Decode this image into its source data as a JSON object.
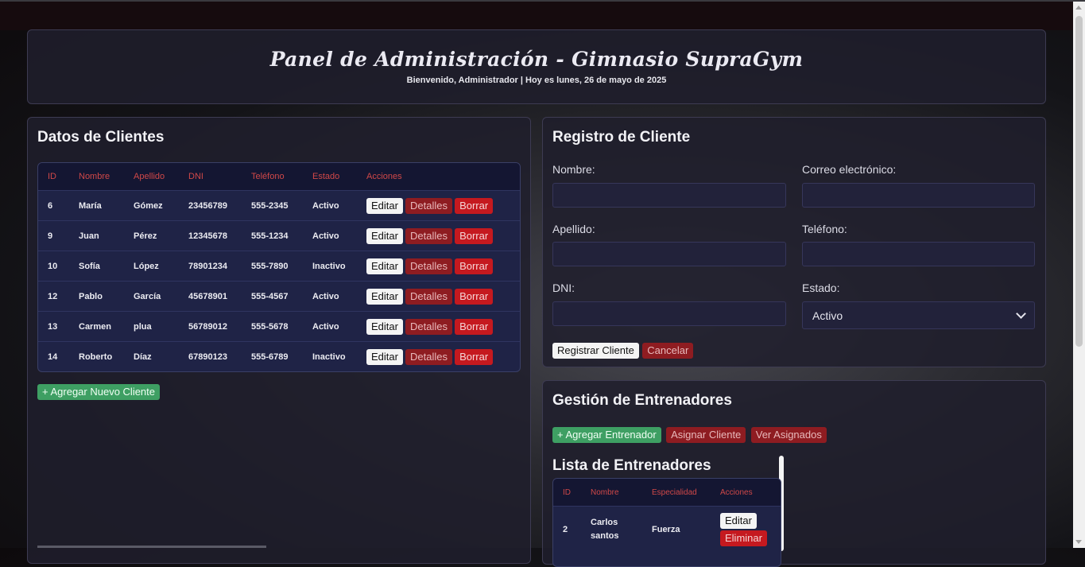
{
  "header": {
    "title": "Panel de Administración - Gimnasio SupraGym",
    "subtitle": "Bienvenido, Administrador | Hoy es lunes, 26 de mayo de 2025"
  },
  "clients": {
    "title": "Datos de Clientes",
    "columns": [
      "ID",
      "Nombre",
      "Apellido",
      "DNI",
      "Teléfono",
      "Estado",
      "Acciones"
    ],
    "rows": [
      {
        "id": "6",
        "nombre": "María",
        "apellido": "Gómez",
        "dni": "23456789",
        "telefono": "555-2345",
        "estado": "Activo"
      },
      {
        "id": "9",
        "nombre": "Juan",
        "apellido": "Pérez",
        "dni": "12345678",
        "telefono": "555-1234",
        "estado": "Activo"
      },
      {
        "id": "10",
        "nombre": "Sofía",
        "apellido": "López",
        "dni": "78901234",
        "telefono": "555-7890",
        "estado": "Inactivo"
      },
      {
        "id": "12",
        "nombre": "Pablo",
        "apellido": "García",
        "dni": "45678901",
        "telefono": "555-4567",
        "estado": "Activo"
      },
      {
        "id": "13",
        "nombre": "Carmen",
        "apellido": "plua",
        "dni": "56789012",
        "telefono": "555-5678",
        "estado": "Activo"
      },
      {
        "id": "14",
        "nombre": "Roberto",
        "apellido": "Díaz",
        "dni": "67890123",
        "telefono": "555-6789",
        "estado": "Inactivo"
      }
    ],
    "actions": {
      "edit": "Editar",
      "details": "Detalles",
      "delete": "Borrar"
    },
    "add_button": "+ Agregar Nuevo Cliente"
  },
  "register": {
    "title": "Registro de Cliente",
    "labels": {
      "nombre": "Nombre:",
      "correo": "Correo electrónico:",
      "apellido": "Apellido:",
      "telefono": "Teléfono:",
      "dni": "DNI:",
      "estado": "Estado:"
    },
    "estado_selected": "Activo",
    "submit": "Registrar Cliente",
    "cancel": "Cancelar"
  },
  "trainers": {
    "title": "Gestión de Entrenadores",
    "buttons": {
      "add": "+ Agregar Entrenador",
      "assign": "Asignar Cliente",
      "view": "Ver Asignados"
    },
    "list_title": "Lista de Entrenadores",
    "columns": [
      "ID",
      "Nombre",
      "Especialidad",
      "Acciones"
    ],
    "rows": [
      {
        "id": "2",
        "nombre": "Carlos santos",
        "especialidad": "Fuerza"
      }
    ],
    "actions": {
      "edit": "Editar",
      "delete": "Eliminar"
    }
  },
  "colors": {
    "accent_red": "#c5191f",
    "dark_red": "#8e1c21",
    "green": "#3e9f63",
    "header_text_red": "#d04848"
  }
}
